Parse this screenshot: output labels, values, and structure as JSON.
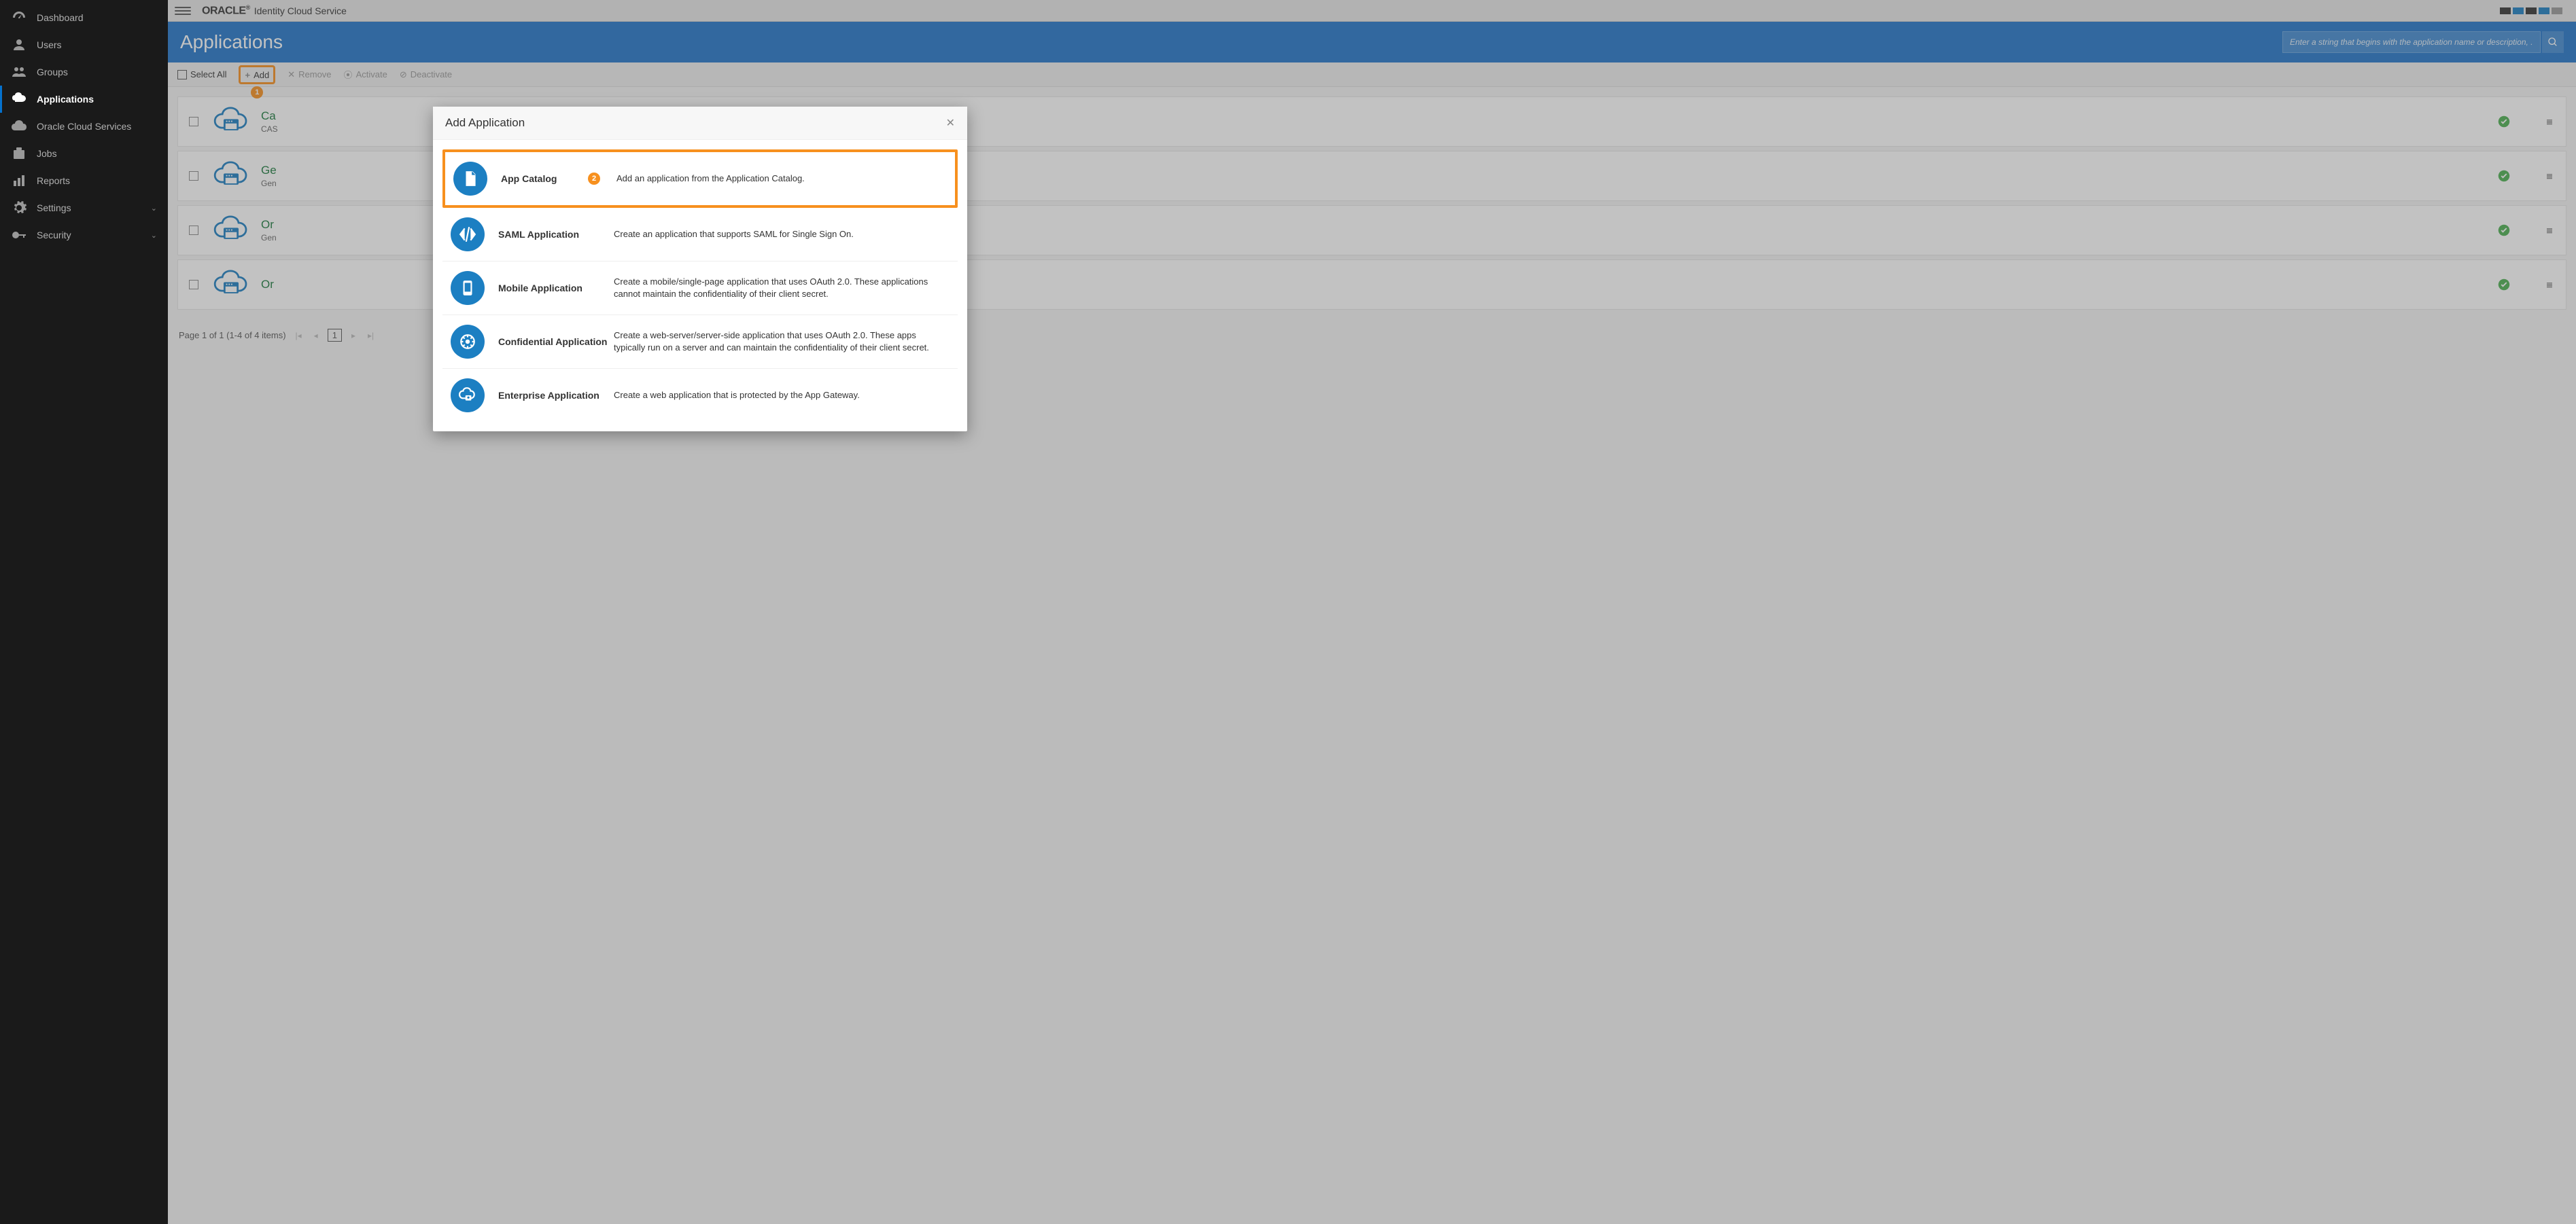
{
  "topbar": {
    "brand": "ORACLE",
    "product": "Identity Cloud Service"
  },
  "sidebar": {
    "items": [
      {
        "label": "Dashboard"
      },
      {
        "label": "Users"
      },
      {
        "label": "Groups"
      },
      {
        "label": "Applications"
      },
      {
        "label": "Oracle Cloud Services"
      },
      {
        "label": "Jobs"
      },
      {
        "label": "Reports"
      },
      {
        "label": "Settings"
      },
      {
        "label": "Security"
      }
    ]
  },
  "page": {
    "title": "Applications",
    "search_placeholder": "Enter a string that begins with the application name or description, ..."
  },
  "toolbar": {
    "select_all": "Select All",
    "add": "Add",
    "remove": "Remove",
    "activate": "Activate",
    "deactivate": "Deactivate"
  },
  "callouts": {
    "b1": "1",
    "b2": "2"
  },
  "rows": [
    {
      "title": "Ca",
      "sub": "CAS"
    },
    {
      "title": "Ge",
      "sub": "Gen"
    },
    {
      "title": "Or",
      "sub": "Gen"
    },
    {
      "title": "Or",
      "sub": ""
    }
  ],
  "pagination": {
    "text": "Page  1  of 1   (1-4 of 4 items)",
    "current": "1"
  },
  "modal": {
    "title": "Add Application",
    "options": [
      {
        "title": "App Catalog",
        "desc": "Add an application from the Application Catalog."
      },
      {
        "title": "SAML Application",
        "desc": "Create an application that supports SAML for Single Sign On."
      },
      {
        "title": "Mobile Application",
        "desc": "Create a mobile/single-page application that uses OAuth 2.0. These applications cannot maintain the confidentiality of their client secret."
      },
      {
        "title": "Confidential Application",
        "desc": "Create a web-server/server-side application that uses OAuth 2.0. These apps typically run on a server and can maintain the confidentiality of their client secret."
      },
      {
        "title": "Enterprise Application",
        "desc": "Create a web application that is protected by the App Gateway."
      }
    ]
  }
}
